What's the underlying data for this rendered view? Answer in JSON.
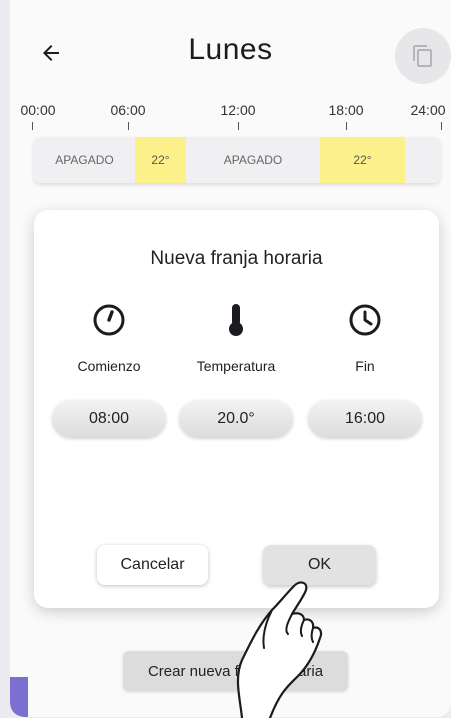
{
  "header": {
    "title": "Lunes",
    "back_icon": "arrow-left-icon",
    "copy_icon": "copy-icon"
  },
  "timeline": {
    "ticks": [
      "00:00",
      "06:00",
      "12:00",
      "18:00",
      "24:00"
    ],
    "segments": [
      {
        "label": "APAGADO",
        "state": "off",
        "start": "00:00",
        "end": "06:00"
      },
      {
        "label": "22°",
        "state": "on",
        "start": "06:00",
        "end": "08:00"
      },
      {
        "label": "APAGADO",
        "state": "off",
        "start": "08:00",
        "end": "16:00"
      },
      {
        "label": "22°",
        "state": "on",
        "start": "16:00",
        "end": "20:00"
      },
      {
        "label": "",
        "state": "off",
        "start": "20:00",
        "end": "24:00"
      }
    ],
    "colors": {
      "on": "#fbf08a",
      "off": "#f0f0f2"
    }
  },
  "dialog": {
    "title": "Nueva franja horaria",
    "start": {
      "label": "Comienzo",
      "value": "08:00",
      "icon": "timer-icon"
    },
    "temperature": {
      "label": "Temperatura",
      "value": "20.0°",
      "icon": "thermometer-icon"
    },
    "end": {
      "label": "Fin",
      "value": "16:00",
      "icon": "clock-icon"
    },
    "cancel_label": "Cancelar",
    "ok_label": "OK"
  },
  "create_button_label": "Crear nueva franja horaria",
  "colors": {
    "accent": "#7b6fd0",
    "background": "#fafafa"
  }
}
